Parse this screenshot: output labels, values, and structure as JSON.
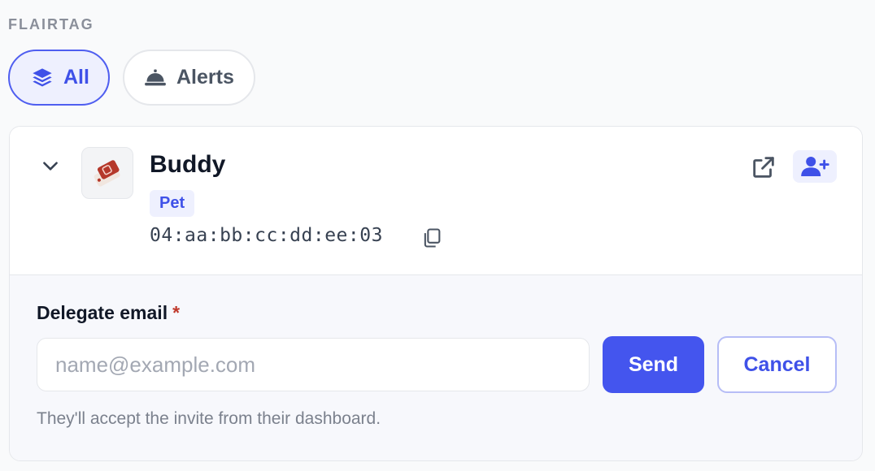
{
  "section": {
    "label": "FLAIRTAG"
  },
  "filters": [
    {
      "label": "All",
      "icon": "layers-icon",
      "active": true
    },
    {
      "label": "Alerts",
      "icon": "bell-icon",
      "active": false
    }
  ],
  "tag": {
    "name": "Buddy",
    "category": "Pet",
    "id": "04:aa:bb:cc:dd:ee:03",
    "thumbnail_icon": "tag-icon",
    "actions": {
      "open_icon": "external-link-icon",
      "delegate_icon": "user-plus-icon"
    }
  },
  "delegate": {
    "label": "Delegate email",
    "required_marker": "*",
    "placeholder": "name@example.com",
    "value": "",
    "send_label": "Send",
    "cancel_label": "Cancel",
    "hint": "They'll accept the invite from their dashboard."
  },
  "colors": {
    "accent": "#4455ee",
    "accent_soft": "#eef0fe",
    "required": "#c0392b",
    "tag_red": "#b5382b"
  }
}
